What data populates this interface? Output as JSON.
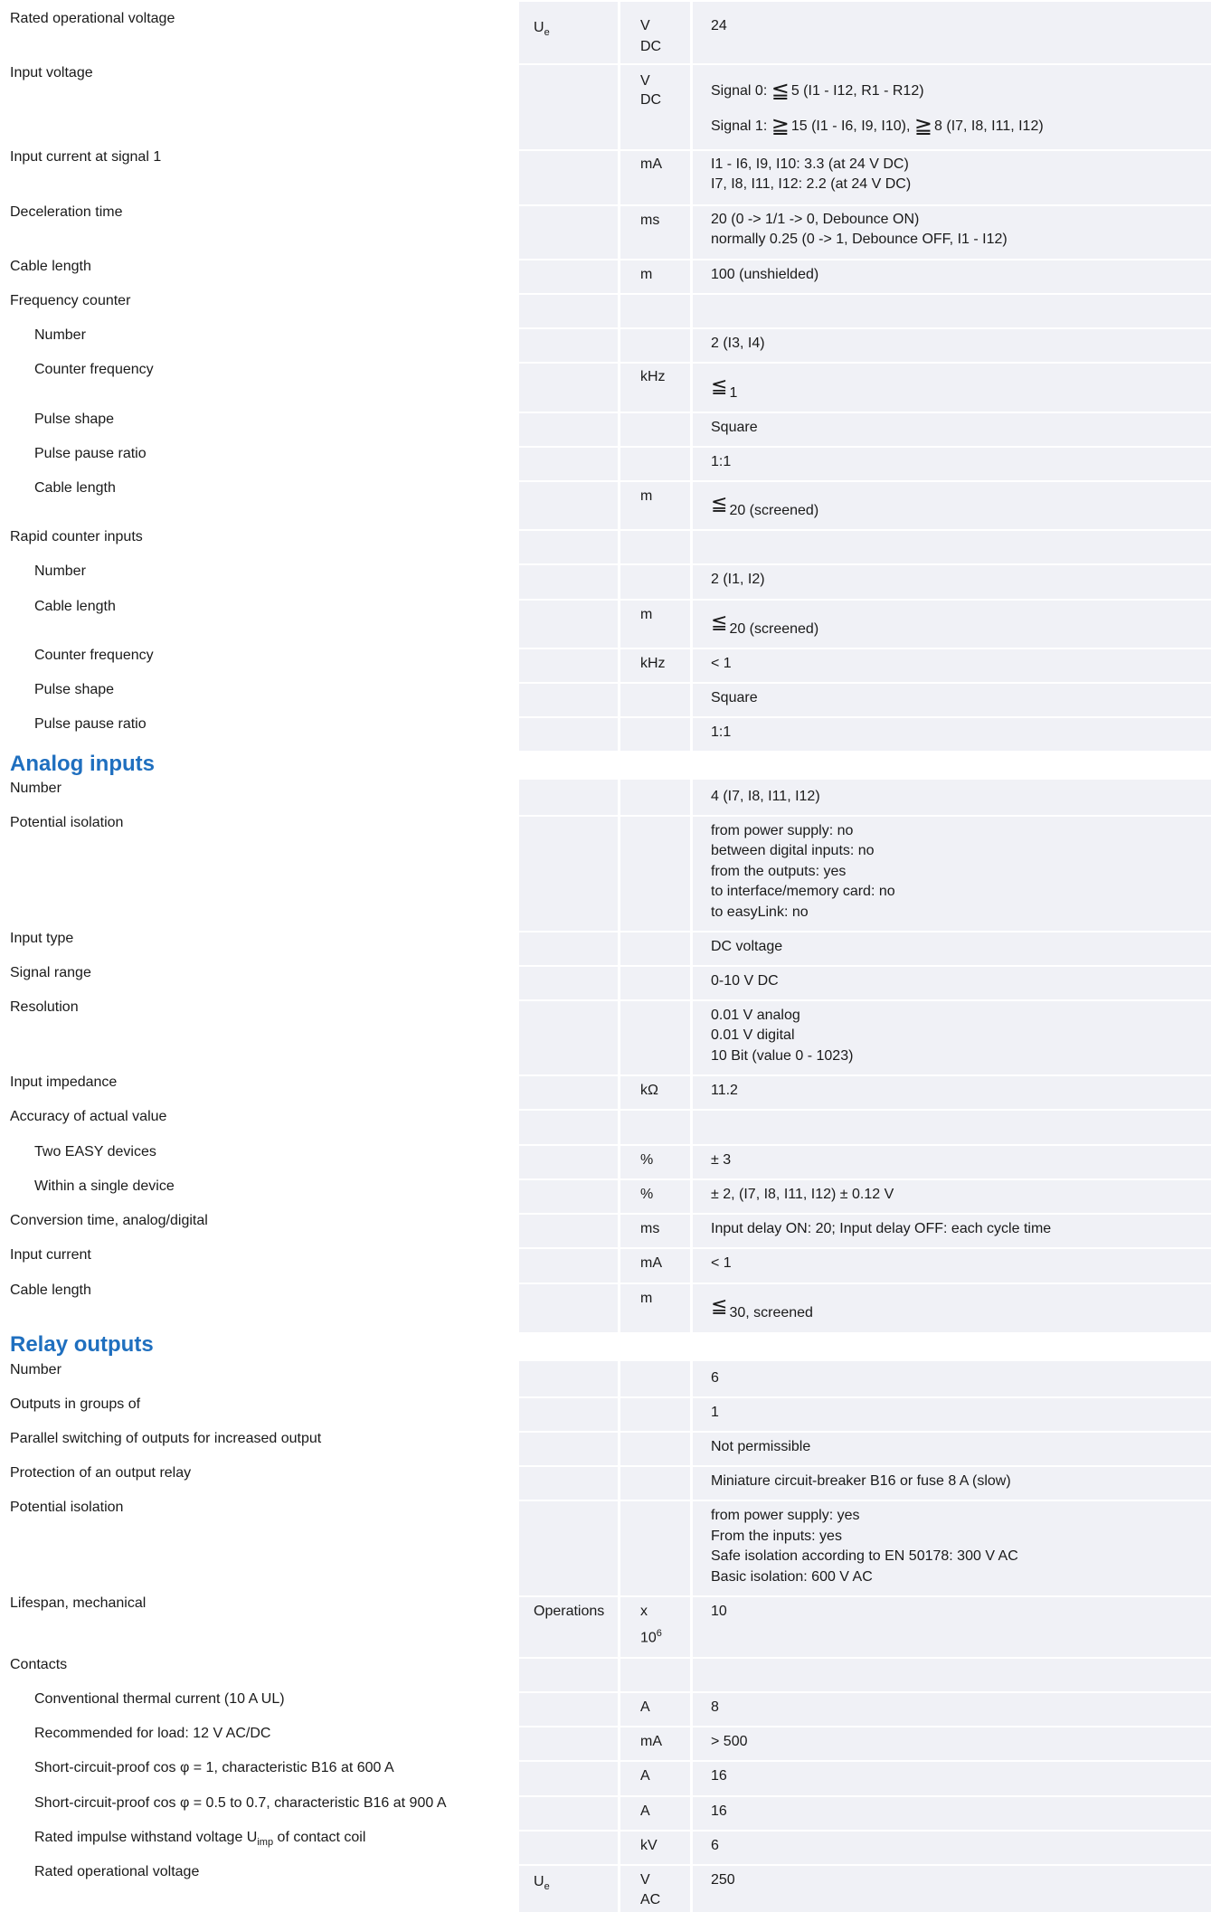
{
  "rows": [
    {
      "label": "Rated operational voltage",
      "sym": "U",
      "sym_sub": "e",
      "unit": "V",
      "unit2": "DC",
      "value": "24"
    },
    {
      "label": "Input voltage",
      "unit": "V",
      "unit2": "DC",
      "v0_prefix": "Signal 0:",
      "v0_num": "5 (I1 - I12, R1 - R12)",
      "v1_prefix": "Signal 1:",
      "v1_a": "15 (I1 - I6, I9, I10),",
      "v1_b": "8 (I7, I8, I11, I12)"
    },
    {
      "label": "Input current at signal 1",
      "unit": "mA",
      "v1": "I1 - I6, I9, I10: 3.3 (at 24 V DC)",
      "v2": "I7, I8, I11, I12: 2.2 (at 24 V DC)"
    },
    {
      "label": "Deceleration time",
      "unit": "ms",
      "v1": "20 (0 -> 1/1 -> 0, Debounce ON)",
      "v2": "normally 0.25 (0 -> 1, Debounce OFF, I1 - I12)"
    },
    {
      "label": "Cable length",
      "unit": "m",
      "value": "100 (unshielded)"
    },
    {
      "label": "Frequency counter"
    },
    {
      "label": "Number",
      "value": "2 (I3, I4)"
    },
    {
      "label": "Counter frequency",
      "unit": "kHz",
      "value": "1"
    },
    {
      "label": "Pulse shape",
      "value": "Square"
    },
    {
      "label": "Pulse pause ratio",
      "value": "1:1"
    },
    {
      "label": "Cable length",
      "unit": "m",
      "value": "20 (screened)"
    },
    {
      "label": "Rapid counter inputs"
    },
    {
      "label": "Number",
      "value": "2 (I1, I2)"
    },
    {
      "label": "Cable length",
      "unit": "m",
      "value": "20 (screened)"
    },
    {
      "label": "Counter frequency",
      "unit": "kHz",
      "value": "< 1"
    },
    {
      "label": "Pulse shape",
      "value": "Square"
    },
    {
      "label": "Pulse pause ratio",
      "value": "1:1"
    }
  ],
  "analog": {
    "heading": "Analog inputs",
    "rows": [
      {
        "label": "Number",
        "value": "4 (I7, I8, I11, I12)"
      },
      {
        "label": "Potential isolation",
        "lines": [
          "from power supply: no",
          "between digital inputs: no",
          "from the outputs: yes",
          "to interface/memory card: no",
          "to easyLink: no"
        ]
      },
      {
        "label": "Input type",
        "value": "DC voltage"
      },
      {
        "label": "Signal range",
        "value": "0-10 V DC"
      },
      {
        "label": "Resolution",
        "lines": [
          "0.01 V analog",
          "0.01 V digital",
          "10 Bit (value 0 - 1023)"
        ]
      },
      {
        "label": "Input impedance",
        "unit": "kΩ",
        "value": "11.2"
      },
      {
        "label": "Accuracy of actual value"
      },
      {
        "label": "Two EASY devices",
        "unit": "%",
        "value": "± 3"
      },
      {
        "label": "Within a single device",
        "unit": "%",
        "value": "± 2, (I7, I8, I11, I12) ± 0.12 V"
      },
      {
        "label": "Conversion time, analog/digital",
        "unit": "ms",
        "value": "Input delay ON: 20; Input delay OFF: each cycle time"
      },
      {
        "label": "Input current",
        "unit": "mA",
        "value": "< 1"
      },
      {
        "label": "Cable length",
        "unit": "m",
        "value": "30, screened"
      }
    ]
  },
  "relay": {
    "heading": "Relay outputs",
    "rows": [
      {
        "label": "Number",
        "value": "6"
      },
      {
        "label": "Outputs in groups of",
        "value": "1"
      },
      {
        "label": "Parallel switching of outputs for increased output",
        "value": "Not permissible"
      },
      {
        "label": "Protection of an output relay",
        "value": "Miniature circuit-breaker B16 or fuse 8 A (slow)"
      },
      {
        "label": "Potential isolation",
        "lines": [
          "from power supply: yes",
          "From the inputs: yes",
          "Safe isolation according to EN 50178: 300 V AC",
          "Basic isolation: 600 V AC"
        ]
      },
      {
        "label": "Lifespan, mechanical",
        "sym": "Operations",
        "unit": "x",
        "unit2": "10",
        "unit2_sup": "6",
        "value": "10"
      },
      {
        "label": "Contacts"
      },
      {
        "label": "Conventional thermal current (10 A UL)",
        "unit": "A",
        "value": "8"
      },
      {
        "label": "Recommended for load: 12 V AC/DC",
        "unit": "mA",
        "value": "> 500"
      },
      {
        "label": "Short-circuit-proof cos φ = 1, characteristic B16 at 600 A",
        "unit": "A",
        "value": "16"
      },
      {
        "label": "Short-circuit-proof cos φ = 0.5 to 0.7, characteristic B16 at 900 A",
        "unit": "A",
        "value": "16"
      },
      {
        "label": "Rated impulse withstand voltage U",
        "label_sub": "imp",
        "label_end": " of contact coil",
        "unit": "kV",
        "value": "6"
      },
      {
        "label": "Rated operational voltage",
        "sym": "U",
        "sym_sub": "e",
        "unit": "V",
        "unit2": "AC",
        "value": "250"
      }
    ]
  },
  "colors": {
    "table_bg": "#f0f1f6",
    "divider": "#ffffff",
    "heading": "#1f6fbf",
    "text": "#1a1a1a"
  },
  "icons": {
    "less_equal": "less-or-equal-icon",
    "greater_equal": "greater-or-equal-icon"
  }
}
